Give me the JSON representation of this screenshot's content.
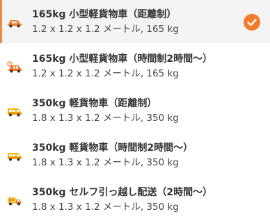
{
  "vehicles": [
    {
      "title": "165kg 小型軽貨物車（距離制）",
      "specs": "1.2 x 1.2 x 1.2 メートル, 165 kg",
      "icon": "small-car-icon",
      "selected": true
    },
    {
      "title": "165kg 小型軽貨物車（時間制2時間～）",
      "specs": "1.2 x 1.2 x 1.2 メートル, 165 kg",
      "icon": "small-car-clock-icon",
      "selected": false
    },
    {
      "title": "350kg 軽貨物車（距離制）",
      "specs": "1.8 x 1.3 x 1.2 メートル, 350 kg",
      "icon": "van-icon",
      "selected": false
    },
    {
      "title": "350kg 軽貨物車（時間制2時間～）",
      "specs": "1.8 x 1.3 x 1.2 メートル, 350 kg",
      "icon": "van-icon",
      "selected": false
    },
    {
      "title": "350kg セルフ引っ越し配送（2時間～）",
      "specs": "1.8 x 1.3 x 1.2 メートル, 350 kg",
      "icon": "moving-truck-icon",
      "selected": false
    }
  ],
  "colors": {
    "accent": "#ef7b2b",
    "van_yellow": "#f4b400",
    "selected_background": "#f4f4f4"
  },
  "check_icon": "checkmark-icon"
}
